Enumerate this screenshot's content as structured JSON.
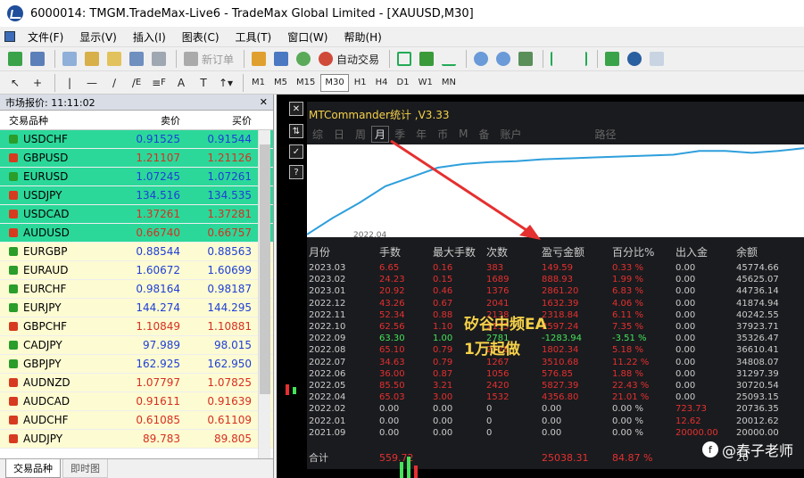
{
  "window": {
    "title": "6000014: TMGM.TradeMax-Live6 - TradeMax Global Limited - [XAUUSD,M30]"
  },
  "menu": [
    "文件(F)",
    "显示(V)",
    "插入(I)",
    "图表(C)",
    "工具(T)",
    "窗口(W)",
    "帮助(H)"
  ],
  "toolbar": {
    "new_order": "新订单",
    "auto_trade": "自动交易"
  },
  "toolbar2_labels": [
    "E",
    "F",
    "A",
    "T"
  ],
  "timeframes": [
    "M1",
    "M5",
    "M15",
    "M30",
    "H1",
    "H4",
    "D1",
    "W1",
    "MN"
  ],
  "active_timeframe": "M30",
  "market": {
    "header": "市场报价: 11:11:02",
    "col_symbol": "交易品种",
    "col_bid": "卖价",
    "col_ask": "买价",
    "rows": [
      {
        "symbol": "USDCHF",
        "bid": "0.91525",
        "ask": "0.91544",
        "dir": "up",
        "bg": "#2bd89a",
        "color": "#1f3fd6"
      },
      {
        "symbol": "GBPUSD",
        "bid": "1.21107",
        "ask": "1.21126",
        "dir": "down",
        "bg": "#2bd89a",
        "color": "#d6301f"
      },
      {
        "symbol": "EURUSD",
        "bid": "1.07245",
        "ask": "1.07261",
        "dir": "up",
        "bg": "#2bd89a",
        "color": "#1f3fd6"
      },
      {
        "symbol": "USDJPY",
        "bid": "134.516",
        "ask": "134.535",
        "dir": "down",
        "bg": "#2bd89a",
        "color": "#1f3fd6"
      },
      {
        "symbol": "USDCAD",
        "bid": "1.37261",
        "ask": "1.37281",
        "dir": "down",
        "bg": "#2bd89a",
        "color": "#d6301f"
      },
      {
        "symbol": "AUDUSD",
        "bid": "0.66740",
        "ask": "0.66757",
        "dir": "down",
        "bg": "#2bd89a",
        "color": "#d6301f"
      },
      {
        "symbol": "EURGBP",
        "bid": "0.88544",
        "ask": "0.88563",
        "dir": "up",
        "bg": "#fdfbd2",
        "color": "#1f3fd6"
      },
      {
        "symbol": "EURAUD",
        "bid": "1.60672",
        "ask": "1.60699",
        "dir": "up",
        "bg": "#fdfbd2",
        "color": "#1f3fd6"
      },
      {
        "symbol": "EURCHF",
        "bid": "0.98164",
        "ask": "0.98187",
        "dir": "up",
        "bg": "#fdfbd2",
        "color": "#1f3fd6"
      },
      {
        "symbol": "EURJPY",
        "bid": "144.274",
        "ask": "144.295",
        "dir": "up",
        "bg": "#fdfbd2",
        "color": "#1f3fd6"
      },
      {
        "symbol": "GBPCHF",
        "bid": "1.10849",
        "ask": "1.10881",
        "dir": "down",
        "bg": "#fdfbd2",
        "color": "#d6301f"
      },
      {
        "symbol": "CADJPY",
        "bid": "97.989",
        "ask": "98.015",
        "dir": "up",
        "bg": "#fdfbd2",
        "color": "#1f3fd6"
      },
      {
        "symbol": "GBPJPY",
        "bid": "162.925",
        "ask": "162.950",
        "dir": "up",
        "bg": "#fdfbd2",
        "color": "#1f3fd6"
      },
      {
        "symbol": "AUDNZD",
        "bid": "1.07797",
        "ask": "1.07825",
        "dir": "down",
        "bg": "#fdfbd2",
        "color": "#d6301f"
      },
      {
        "symbol": "AUDCAD",
        "bid": "0.91611",
        "ask": "0.91639",
        "dir": "down",
        "bg": "#fdfbd2",
        "color": "#d6301f"
      },
      {
        "symbol": "AUDCHF",
        "bid": "0.61085",
        "ask": "0.61109",
        "dir": "down",
        "bg": "#fdfbd2",
        "color": "#d6301f"
      },
      {
        "symbol": "AUDJPY",
        "bid": "89.783",
        "ask": "89.805",
        "dir": "down",
        "bg": "#fdfbd2",
        "color": "#d6301f"
      }
    ],
    "tabs": [
      "交易品种",
      "即时图"
    ]
  },
  "panel": {
    "title": "MTCommander统计 ,V3.33",
    "tabs": [
      "综",
      "日",
      "周",
      "月",
      "季",
      "年",
      "币",
      "M",
      "备",
      "账户",
      "路径"
    ],
    "selected_tab": "月",
    "curve_date": "2022.04",
    "curve_points": [
      0.03,
      0.21,
      0.37,
      0.55,
      0.65,
      0.75,
      0.79,
      0.81,
      0.82,
      0.84,
      0.85,
      0.86,
      0.87,
      0.88,
      0.89,
      0.93,
      0.93,
      0.91,
      0.93,
      0.96
    ],
    "columns": [
      "月份",
      "手数",
      "最大手数",
      "次数",
      "盈亏金额",
      "百分比%",
      "出入金",
      "余额"
    ],
    "rows": [
      [
        "2023.03",
        "6.65",
        "0.16",
        "383",
        "149.59",
        "0.33 %",
        "0.00",
        "45774.66"
      ],
      [
        "2023.02",
        "24.23",
        "0.15",
        "1689",
        "888.93",
        "1.99 %",
        "0.00",
        "45625.07"
      ],
      [
        "2023.01",
        "20.92",
        "0.46",
        "1376",
        "2861.20",
        "6.83 %",
        "0.00",
        "44736.14"
      ],
      [
        "2022.12",
        "43.26",
        "0.67",
        "2041",
        "1632.39",
        "4.06 %",
        "0.00",
        "41874.94"
      ],
      [
        "2022.11",
        "52.34",
        "0.88",
        "2138",
        "2318.84",
        "6.11 %",
        "0.00",
        "40242.55"
      ],
      [
        "2022.10",
        "62.56",
        "1.10",
        "2135",
        "2597.24",
        "7.35 %",
        "0.00",
        "37923.71"
      ],
      [
        "2022.09",
        "63.30",
        "1.00",
        "2781",
        "-1283.94",
        "-3.51 %",
        "0.00",
        "35326.47"
      ],
      [
        "2022.08",
        "65.10",
        "0.79",
        "2779",
        "1802.34",
        "5.18 %",
        "0.00",
        "36610.41"
      ],
      [
        "2022.07",
        "34.63",
        "0.79",
        "1267",
        "3510.68",
        "11.22 %",
        "0.00",
        "34808.07"
      ],
      [
        "2022.06",
        "36.00",
        "0.87",
        "1056",
        "576.85",
        "1.88 %",
        "0.00",
        "31297.39"
      ],
      [
        "2022.05",
        "85.50",
        "3.21",
        "2420",
        "5827.39",
        "22.43 %",
        "0.00",
        "30720.54"
      ],
      [
        "2022.04",
        "65.03",
        "3.00",
        "1532",
        "4356.80",
        "21.01 %",
        "0.00",
        "25093.15"
      ],
      [
        "2022.02",
        "0.00",
        "0.00",
        "0",
        "0.00",
        "0.00 %",
        "723.73",
        "20736.35"
      ],
      [
        "2022.01",
        "0.00",
        "0.00",
        "0",
        "0.00",
        "0.00 %",
        "12.62",
        "20012.62"
      ],
      [
        "2021.09",
        "0.00",
        "0.00",
        "0",
        "0.00",
        "0.00 %",
        "20000.00",
        "20000.00"
      ]
    ],
    "total": [
      "合计",
      "559.72",
      "",
      "",
      "25038.31",
      "84.87 %",
      "",
      "20"
    ]
  },
  "overlay_text": [
    "矽谷中频EA",
    "1万起做"
  ],
  "watermark": "@春子老师",
  "colors": {
    "green_row": "#2bd89a",
    "yellow_row": "#fdfbd2",
    "loss": "#e53030",
    "gain": "#45e25a",
    "gold": "#f5d14a",
    "arrow": "#e53030"
  }
}
